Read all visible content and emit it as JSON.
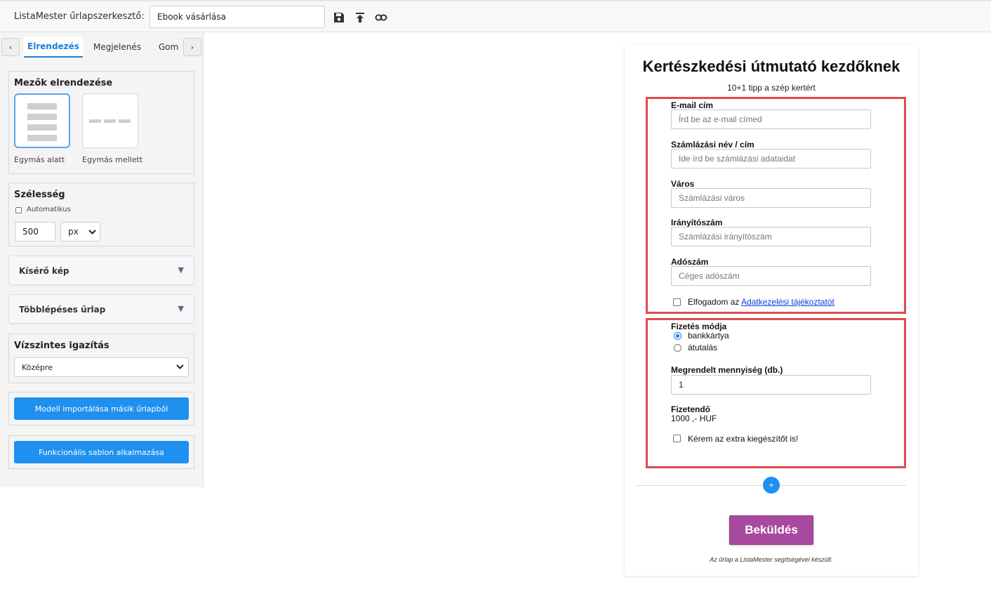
{
  "topbar": {
    "app_label": "ListaMester űrlapszerkesztő:",
    "form_name": "Ebook vásárlása",
    "icons": [
      "save-icon",
      "upload-icon",
      "link-icon"
    ]
  },
  "sidebar": {
    "tabs": {
      "prev": "‹",
      "next": "›",
      "items": [
        "Elrendezés",
        "Megjelenés",
        "Gom"
      ],
      "active": "Elrendezés"
    },
    "field_layout": {
      "title": "Mezők elrendezése",
      "options": [
        "Egymás alatt",
        "Egymás mellett"
      ],
      "selected": "Egymás alatt"
    },
    "width": {
      "title": "Szélesség",
      "auto_label": "Automatikus",
      "value": "500",
      "unit": "px"
    },
    "collapsibles": [
      "Kísérő kép",
      "Többlépéses űrlap"
    ],
    "alignment": {
      "title": "Vízszintes igazítás",
      "value": "Középre"
    },
    "buttons": {
      "import_model": "Modell importálása másik űrlapból",
      "apply_template": "Funkcionális sablon alkalmazása"
    }
  },
  "form": {
    "title": "Kertészkedési útmutató kezdőknek",
    "subtitle": "10+1 tipp a szép kertért",
    "group1": {
      "fields": [
        {
          "label": "E-mail cím",
          "placeholder": "Írd be az e-mail címed"
        },
        {
          "label": "Számlázási név / cím",
          "placeholder": "Ide írd be számlázási adataidat"
        },
        {
          "label": "Város",
          "placeholder": "Számlázási város"
        },
        {
          "label": "Irányítószám",
          "placeholder": "Számlázási irányítószám"
        },
        {
          "label": "Adószám",
          "placeholder": "Céges adószám"
        }
      ],
      "consent_prefix": "Elfogadom az",
      "consent_link": "Adatkezelési tájékoztatót"
    },
    "group2": {
      "payment_label": "Fizetés módja",
      "payment_options": [
        "bankkártya",
        "átutalás"
      ],
      "payment_selected": "bankkártya",
      "quantity_label": "Megrendelt mennyiség (db.)",
      "quantity_value": "1",
      "total_label": "Fizetendő",
      "total_value": "1000 ,- HUF",
      "extra_label": "Kérem az extra kiegészítőt is!"
    },
    "add_button": "+",
    "submit_label": "Beküldés",
    "footer_note": "Az űrlap a ListaMester segítségével készült."
  },
  "colors": {
    "accent_blue": "#1e90f0",
    "highlight_red": "#e14b4b",
    "submit_purple": "#a84a9f"
  }
}
